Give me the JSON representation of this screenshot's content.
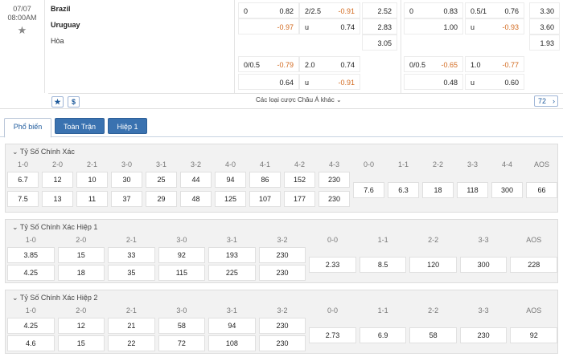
{
  "match": {
    "date": "07/07",
    "time": "08:00AM",
    "home": "Brazil",
    "away": "Uruguay",
    "draw": "Hòa"
  },
  "odds": {
    "left": {
      "row1": [
        {
          "h": "0",
          "v": "0.82"
        },
        {
          "h": "2/2.5",
          "v": "-0.91"
        },
        {
          "h": "",
          "v": "2.52"
        }
      ],
      "row2": [
        {
          "h": "",
          "v": "-0.97"
        },
        {
          "h": "u",
          "v": "0.74"
        },
        {
          "h": "",
          "v": "2.83"
        }
      ],
      "row3": [
        {
          "h": "",
          "v": "3.05"
        }
      ],
      "row4": [
        {
          "h": "0/0.5",
          "v": "-0.79"
        },
        {
          "h": "2.0",
          "v": "0.74"
        }
      ],
      "row5": [
        {
          "h": "",
          "v": "0.64"
        },
        {
          "h": "u",
          "v": "-0.91"
        }
      ]
    },
    "right": {
      "row1": [
        {
          "h": "0",
          "v": "0.83"
        },
        {
          "h": "0.5/1",
          "v": "0.76"
        },
        {
          "h": "",
          "v": "3.30"
        }
      ],
      "row2": [
        {
          "h": "",
          "v": "1.00"
        },
        {
          "h": "u",
          "v": "-0.93"
        },
        {
          "h": "",
          "v": "3.60"
        }
      ],
      "row3": [
        {
          "h": "",
          "v": "1.93"
        }
      ],
      "row4": [
        {
          "h": "0/0.5",
          "v": "-0.65"
        },
        {
          "h": "1.0",
          "v": "-0.77"
        }
      ],
      "row5": [
        {
          "h": "",
          "v": "0.48"
        },
        {
          "h": "u",
          "v": "0.60"
        }
      ]
    }
  },
  "toolbar": {
    "star_btn": "★",
    "dollar_btn": "$",
    "more_label": "Các loại cược Châu Á khác",
    "more_icon": "chevron-down-icon",
    "count": "72"
  },
  "tabs": [
    "Phổ biến",
    "Toàn Trận",
    "Hiệp 1"
  ],
  "sections": [
    {
      "title": "Tỷ Số Chính Xác",
      "headers": [
        "1-0",
        "2-0",
        "2-1",
        "3-0",
        "3-1",
        "3-2",
        "4-0",
        "4-1",
        "4-2",
        "4-3",
        "0-0",
        "1-1",
        "2-2",
        "3-3",
        "4-4",
        "AOS"
      ],
      "row_home": [
        "6.7",
        "12",
        "10",
        "30",
        "25",
        "44",
        "94",
        "86",
        "152",
        "230"
      ],
      "row_away": [
        "7.5",
        "13",
        "11",
        "37",
        "29",
        "48",
        "125",
        "107",
        "177",
        "230"
      ],
      "draws": [
        "7.6",
        "6.3",
        "18",
        "118",
        "300",
        "66"
      ]
    },
    {
      "title": "Tỷ Số Chính Xác Hiệp 1",
      "headers": [
        "1-0",
        "2-0",
        "2-1",
        "3-0",
        "3-1",
        "3-2",
        "0-0",
        "1-1",
        "2-2",
        "3-3",
        "AOS"
      ],
      "row_home": [
        "3.85",
        "15",
        "33",
        "92",
        "193",
        "230"
      ],
      "row_away": [
        "4.25",
        "18",
        "35",
        "115",
        "225",
        "230"
      ],
      "draws": [
        "2.33",
        "8.5",
        "120",
        "300",
        "228"
      ]
    },
    {
      "title": "Tỷ Số Chính Xác Hiệp 2",
      "headers": [
        "1-0",
        "2-0",
        "2-1",
        "3-0",
        "3-1",
        "3-2",
        "0-0",
        "1-1",
        "2-2",
        "3-3",
        "AOS"
      ],
      "row_home": [
        "4.25",
        "12",
        "21",
        "58",
        "94",
        "230"
      ],
      "row_away": [
        "4.6",
        "15",
        "22",
        "72",
        "108",
        "230"
      ],
      "draws": [
        "2.73",
        "6.9",
        "58",
        "230",
        "92"
      ]
    }
  ]
}
